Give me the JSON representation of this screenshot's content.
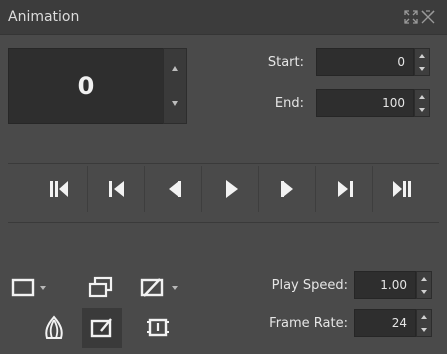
{
  "panel": {
    "title": "Animation"
  },
  "current_frame": {
    "value": "0"
  },
  "start": {
    "label": "Start:",
    "value": "0"
  },
  "end": {
    "label": "End:",
    "value": "100"
  },
  "transport": {
    "buttons": [
      "jump-to-start-icon",
      "previous-keyframe-icon",
      "previous-frame-icon",
      "play-icon",
      "next-frame-icon",
      "next-keyframe-icon",
      "jump-to-end-icon"
    ]
  },
  "play_speed": {
    "label": "Play Speed:",
    "value": "1.00"
  },
  "frame_rate": {
    "label": "Frame Rate:",
    "value": "24"
  },
  "colors": {
    "panel_bg": "#4a4a4a",
    "titlebar_bg": "#3c3c3c",
    "field_bg": "#2e2e2e",
    "icon": "#f2f2f2"
  }
}
